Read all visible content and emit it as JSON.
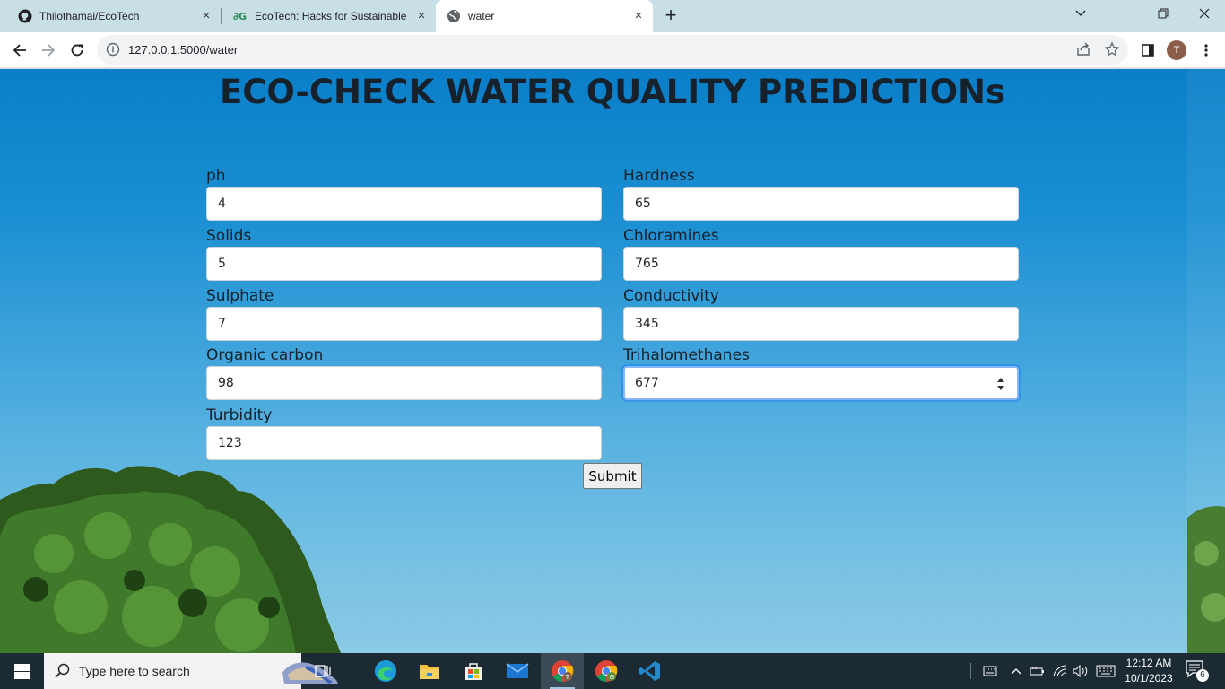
{
  "browser": {
    "tabs": [
      {
        "title": "Thilothamai/EcoTech",
        "icon": "github-icon",
        "close": "×"
      },
      {
        "title": "EcoTech: Hacks for Sustainable T",
        "icon": "devpost-icon",
        "close": "×"
      },
      {
        "title": "water",
        "icon": "globe-icon",
        "close": "×"
      }
    ],
    "new_tab": "+",
    "url": "127.0.0.1:5000/water",
    "profile_initial": "T"
  },
  "page": {
    "title": "ECO-CHECK WATER QUALITY PREDICTIONs",
    "fields": [
      {
        "label": "ph",
        "value": "4"
      },
      {
        "label": "Hardness",
        "value": "65"
      },
      {
        "label": "Solids",
        "value": "5"
      },
      {
        "label": "Chloramines",
        "value": "765"
      },
      {
        "label": "Sulphate",
        "value": "7"
      },
      {
        "label": "Conductivity",
        "value": "345"
      },
      {
        "label": "Organic carbon",
        "value": "98"
      },
      {
        "label": "Trihalomethanes",
        "value": "677"
      },
      {
        "label": "Turbidity",
        "value": "123"
      }
    ],
    "submit_label": "Submit"
  },
  "taskbar": {
    "search_placeholder": "Type here to search",
    "time": "12:12 AM",
    "date": "10/1/2023",
    "notification_count": "6"
  }
}
